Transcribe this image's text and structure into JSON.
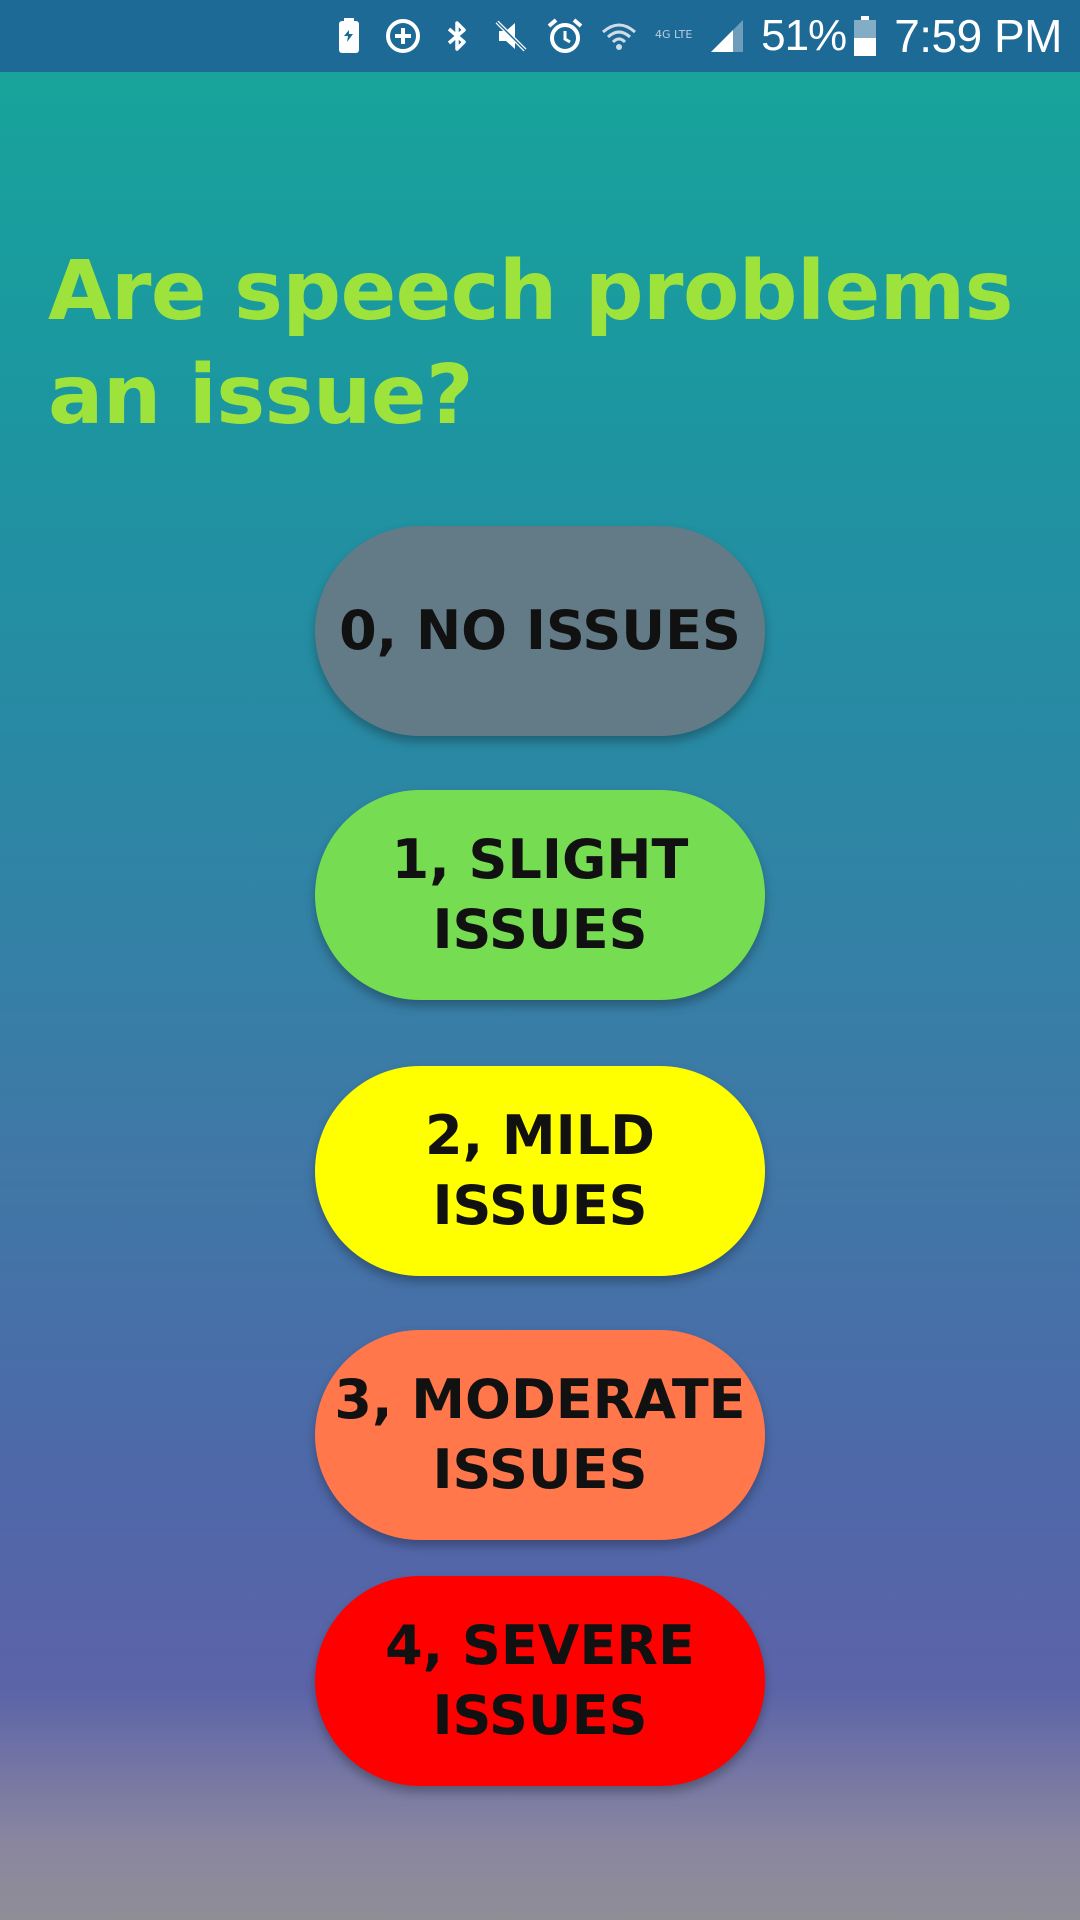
{
  "status_bar": {
    "icons": [
      "battery-saver-icon",
      "data-saver-icon",
      "bluetooth-icon",
      "mute-icon",
      "alarm-icon",
      "wifi-icon",
      "lte-icon",
      "signal-icon"
    ],
    "lte_label": "4G LTE",
    "battery_percent": "51%",
    "battery_level": 0.51,
    "time": "7:59 PM"
  },
  "question": {
    "text": "Are speech problems an issue?"
  },
  "answers": [
    {
      "label": "0, NO ISSUES",
      "color": "#627b87"
    },
    {
      "label": "1, SLIGHT\nISSUES",
      "color": "#76dd52"
    },
    {
      "label": "2, MILD ISSUES",
      "color": "#ffff00"
    },
    {
      "label": "3, MODERATE\nISSUES",
      "color": "#ff774b"
    },
    {
      "label": "4, SEVERE\nISSUES",
      "color": "#ff0000"
    }
  ],
  "colors": {
    "status_bar": "#1e6a97",
    "question_text": "#9ee33c"
  }
}
